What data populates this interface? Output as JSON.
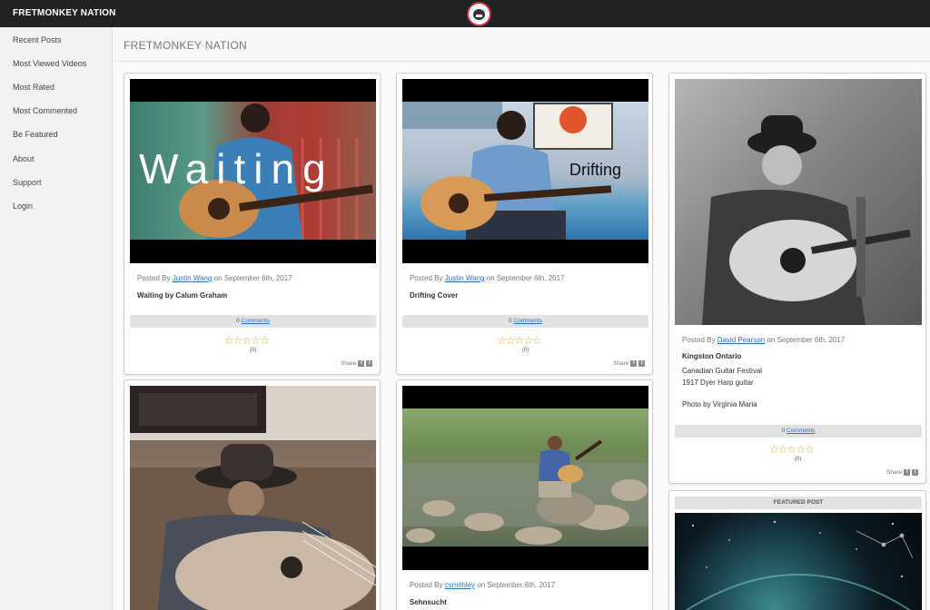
{
  "app": {
    "brand": "FRETMONKEY NATION",
    "page_title": "FRETMONKEY NATION"
  },
  "sidebar": {
    "items": [
      {
        "label": "Recent Posts"
      },
      {
        "label": "Most Viewed Videos"
      },
      {
        "label": "Most Rated"
      },
      {
        "label": "Most Commented"
      },
      {
        "label": "Be Featured"
      },
      {
        "label": "About"
      },
      {
        "label": "Support"
      },
      {
        "label": "Login"
      }
    ]
  },
  "common": {
    "posted_by": "Posted By",
    "on": "on",
    "comments_label": "Comments",
    "share_label": "Share",
    "stars": "☆☆☆☆☆",
    "featured_label": "FEATURED POST",
    "star_color": "#e8b000",
    "link_color": "#2a6fdb"
  },
  "posts": [
    {
      "author": "Justin Wang",
      "date": "September 6th, 2017",
      "title": "Waiting by Calum Graham",
      "comment_count": "0",
      "rating_count": "(0)",
      "overlay": "Waiting"
    },
    {
      "author": "Justin Wang",
      "date": "September 6th, 2017",
      "title": "Drifting Cover",
      "comment_count": "0",
      "rating_count": "(0)",
      "overlay": "Drifting"
    },
    {
      "author": "David Pearson",
      "date": "September 6th, 2017",
      "title": "Kingston Ontario",
      "desc1": "Canadian Guitar Festival",
      "desc2": "1917 Dyer Harp guitar",
      "desc3": "Photo by Virginia Maria",
      "comment_count": "0",
      "rating_count": "(0)"
    },
    {
      "author": "csmithley",
      "date": "September 6th, 2017",
      "title": "Sehnsucht"
    }
  ],
  "icons": {
    "logo": "fretmonkey-logo-icon",
    "facebook": "facebook-icon",
    "twitter": "twitter-icon"
  }
}
